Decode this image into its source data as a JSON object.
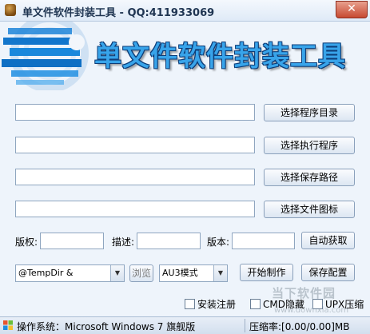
{
  "window": {
    "title": "单文件软件封装工具 - QQ:411933069",
    "close_symbol": "✕"
  },
  "banner": {
    "title": "单文件软件封装工具"
  },
  "paths": {
    "program_dir": "",
    "exec_program": "",
    "save_path": "",
    "file_icon": ""
  },
  "buttons": {
    "select_program_dir": "选择程序目录",
    "select_exec_program": "选择执行程序",
    "select_save_path": "选择保存路径",
    "select_file_icon": "选择文件图标",
    "auto_fetch": "自动获取",
    "browse": "浏览",
    "start_build": "开始制作",
    "save_config": "保存配置"
  },
  "info": {
    "copyright_label": "版权:",
    "copyright_value": "",
    "description_label": "描述:",
    "description_value": "",
    "version_label": "版本:",
    "version_value": ""
  },
  "options": {
    "temp_dir_value": "@TempDir &",
    "mode_value": "AU3模式",
    "install_register": "安装注册",
    "cmd_hide": "CMD隐藏",
    "upx_compress": "UPX压缩"
  },
  "status": {
    "os": "操作系统：Microsoft Windows 7 旗舰版",
    "compression_rate": "压缩率:[0.00/0.00]MB"
  },
  "watermark": {
    "site_cn": "当下软件园",
    "site_en": "www.downxia.com"
  }
}
